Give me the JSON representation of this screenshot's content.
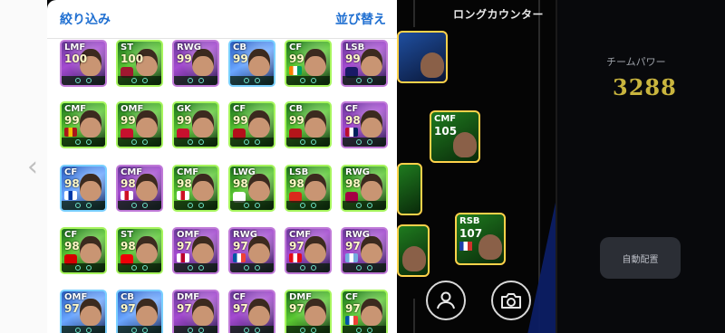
{
  "panel": {
    "filter_label": "絞り込み",
    "sort_label": "並び替え"
  },
  "formation": {
    "long_counter": "ロングカウンター"
  },
  "team_power": {
    "label": "チームパワー",
    "value": "3288"
  },
  "buttons": {
    "auto_arrange": "自動配置"
  },
  "pitch_cards": [
    {
      "pos": "CMF",
      "rating": "105"
    },
    {
      "pos": "RSB",
      "rating": "107"
    }
  ],
  "players": [
    {
      "pos": "LMF",
      "rating": "100",
      "style": "purple"
    },
    {
      "pos": "ST",
      "rating": "100",
      "style": "green",
      "badge": "#a01830"
    },
    {
      "pos": "RWG",
      "rating": "99",
      "style": "purple"
    },
    {
      "pos": "CB",
      "rating": "99",
      "style": "blue"
    },
    {
      "pos": "CF",
      "rating": "99",
      "style": "green",
      "flag": [
        "#f77f00",
        "#ffffff",
        "#009e60"
      ]
    },
    {
      "pos": "LSB",
      "rating": "99",
      "style": "purple",
      "badge": "#1a1a66"
    },
    {
      "pos": "CMF",
      "rating": "99",
      "style": "green",
      "flag": [
        "#aa151b",
        "#f1bf00",
        "#aa151b"
      ]
    },
    {
      "pos": "OMF",
      "rating": "99",
      "style": "green",
      "badge": "#c8102e"
    },
    {
      "pos": "GK",
      "rating": "99",
      "style": "green",
      "badge": "#c8102e"
    },
    {
      "pos": "CF",
      "rating": "99",
      "style": "green",
      "badge": "#b30f1b"
    },
    {
      "pos": "CB",
      "rating": "99",
      "style": "green",
      "badge": "#b4151a"
    },
    {
      "pos": "CF",
      "rating": "98",
      "style": "purple",
      "flag": [
        "#ba0c2f",
        "#ffffff",
        "#00205b"
      ]
    },
    {
      "pos": "CF",
      "rating": "98",
      "style": "blue",
      "flag": [
        "#ffffff",
        "#0038a8",
        "#ffffff"
      ]
    },
    {
      "pos": "CMF",
      "rating": "98",
      "style": "purple",
      "flag": [
        "#ffffff",
        "#ce1124",
        "#ffffff"
      ]
    },
    {
      "pos": "CMF",
      "rating": "98",
      "style": "green",
      "flag": [
        "#ffffff",
        "#ce1124",
        "#ffffff"
      ]
    },
    {
      "pos": "LWG",
      "rating": "98",
      "style": "green",
      "badge": "#ffffff"
    },
    {
      "pos": "LSB",
      "rating": "98",
      "style": "green",
      "badge": "#da291c"
    },
    {
      "pos": "RWG",
      "rating": "98",
      "style": "green",
      "badge": "#a50044"
    },
    {
      "pos": "CF",
      "rating": "98",
      "style": "green",
      "badge": "#d50000"
    },
    {
      "pos": "ST",
      "rating": "98",
      "style": "green",
      "badge": "#ef0107"
    },
    {
      "pos": "OMF",
      "rating": "97",
      "style": "purple",
      "flag": [
        "#ffffff",
        "#bc002d",
        "#ffffff"
      ]
    },
    {
      "pos": "RWG",
      "rating": "97",
      "style": "purple",
      "flag": [
        "#0055a4",
        "#ffffff",
        "#ef4135"
      ]
    },
    {
      "pos": "CMF",
      "rating": "97",
      "style": "purple",
      "flag": [
        "#e30a17",
        "#ffffff",
        "#e30a17"
      ]
    },
    {
      "pos": "RWG",
      "rating": "97",
      "style": "purple",
      "flag": [
        "#74acdf",
        "#ffffff",
        "#74acdf"
      ]
    },
    {
      "pos": "OMF",
      "rating": "97",
      "style": "blue"
    },
    {
      "pos": "CB",
      "rating": "97",
      "style": "blue"
    },
    {
      "pos": "DMF",
      "rating": "97",
      "style": "purple"
    },
    {
      "pos": "CF",
      "rating": "97",
      "style": "purple"
    },
    {
      "pos": "DMF",
      "rating": "97",
      "style": "green"
    },
    {
      "pos": "CF",
      "rating": "97",
      "style": "green",
      "flag": [
        "#0055a4",
        "#ffffff",
        "#ef4135"
      ]
    }
  ]
}
